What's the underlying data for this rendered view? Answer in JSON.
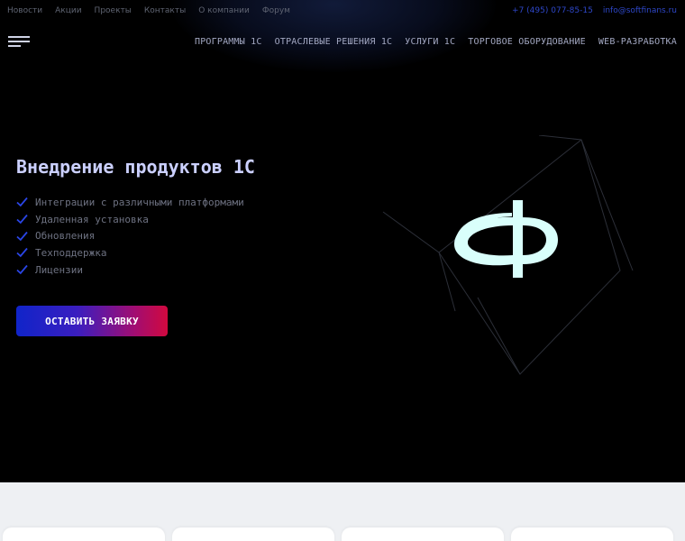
{
  "topnav": {
    "items": [
      "Новости",
      "Акции",
      "Проекты",
      "Контакты",
      "О компании",
      "Форум"
    ]
  },
  "contacts": {
    "phone": "+7 (495) 077-85-15",
    "email": "info@softfinans.ru"
  },
  "mainnav": {
    "items": [
      "ПРОГРАММЫ 1С",
      "ОТРАСЛЕВЫЕ РЕШЕНИЯ 1С",
      "УСЛУГИ 1С",
      "ТОРГОВОЕ ОБОРУДОВАНИЕ",
      "WEB-РАЗРАБОТКА"
    ]
  },
  "hero": {
    "title": "Внедрение продуктов 1С",
    "features": [
      "Интеграции с различными платформами",
      "Удаленная установка",
      "Обновления",
      "Техподдержка",
      "Лицензии"
    ],
    "cta_label": "ОСТАВИТЬ ЗАЯВКУ"
  },
  "icons": {
    "menu": "hamburger-menu-icon",
    "check": "checkmark-icon",
    "logo": "phi-logo-icon"
  },
  "colors": {
    "background": "#000000",
    "title": "#cbd0ff",
    "check": "#2a45e6",
    "link_accent": "#2e47c8",
    "logo": "#d9fffb",
    "cta_gradient_start": "#1024c9",
    "cta_gradient_end": "#d1093f",
    "lower_section": "#eef0f3"
  }
}
